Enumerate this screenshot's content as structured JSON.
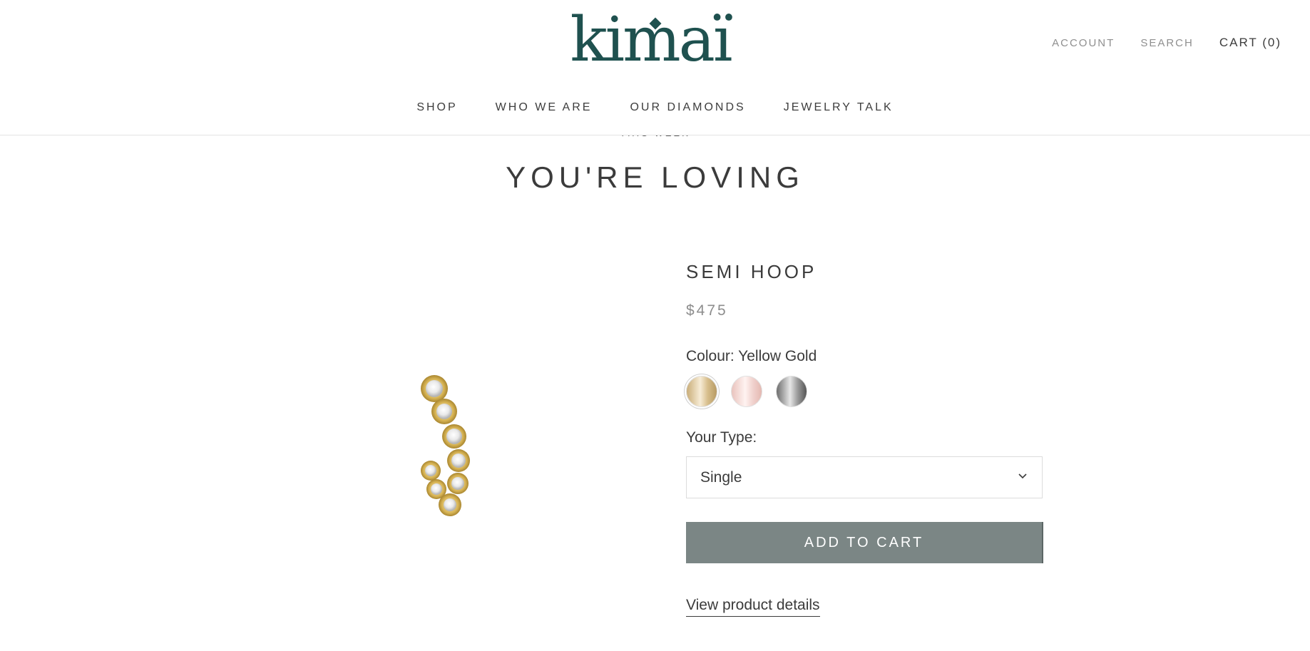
{
  "header": {
    "logo_text": "kima",
    "account_label": "ACCOUNT",
    "search_label": "SEARCH",
    "cart_label": "CART (0)"
  },
  "nav": {
    "items": [
      "SHOP",
      "WHO WE ARE",
      "OUR DIAMONDS",
      "JEWELRY TALK"
    ]
  },
  "section": {
    "eyebrow": "THIS WEEK",
    "title": "YOU'RE LOVING"
  },
  "product": {
    "name": "SEMI HOOP",
    "price": "$475",
    "colour_label": "Colour: Yellow Gold",
    "swatches": [
      {
        "name": "Yellow Gold",
        "color": "#d7be8c",
        "selected": true
      },
      {
        "name": "Rose Gold",
        "color": "#f1d3cf",
        "selected": false
      },
      {
        "name": "White Gold",
        "color": "#9c9c9c",
        "selected": false
      }
    ],
    "type_label": "Your Type:",
    "type_value": "Single",
    "add_to_cart": "ADD TO CART",
    "details_link": "View product details"
  },
  "colors": {
    "brand": "#1f514f",
    "button": "#7b8685"
  }
}
